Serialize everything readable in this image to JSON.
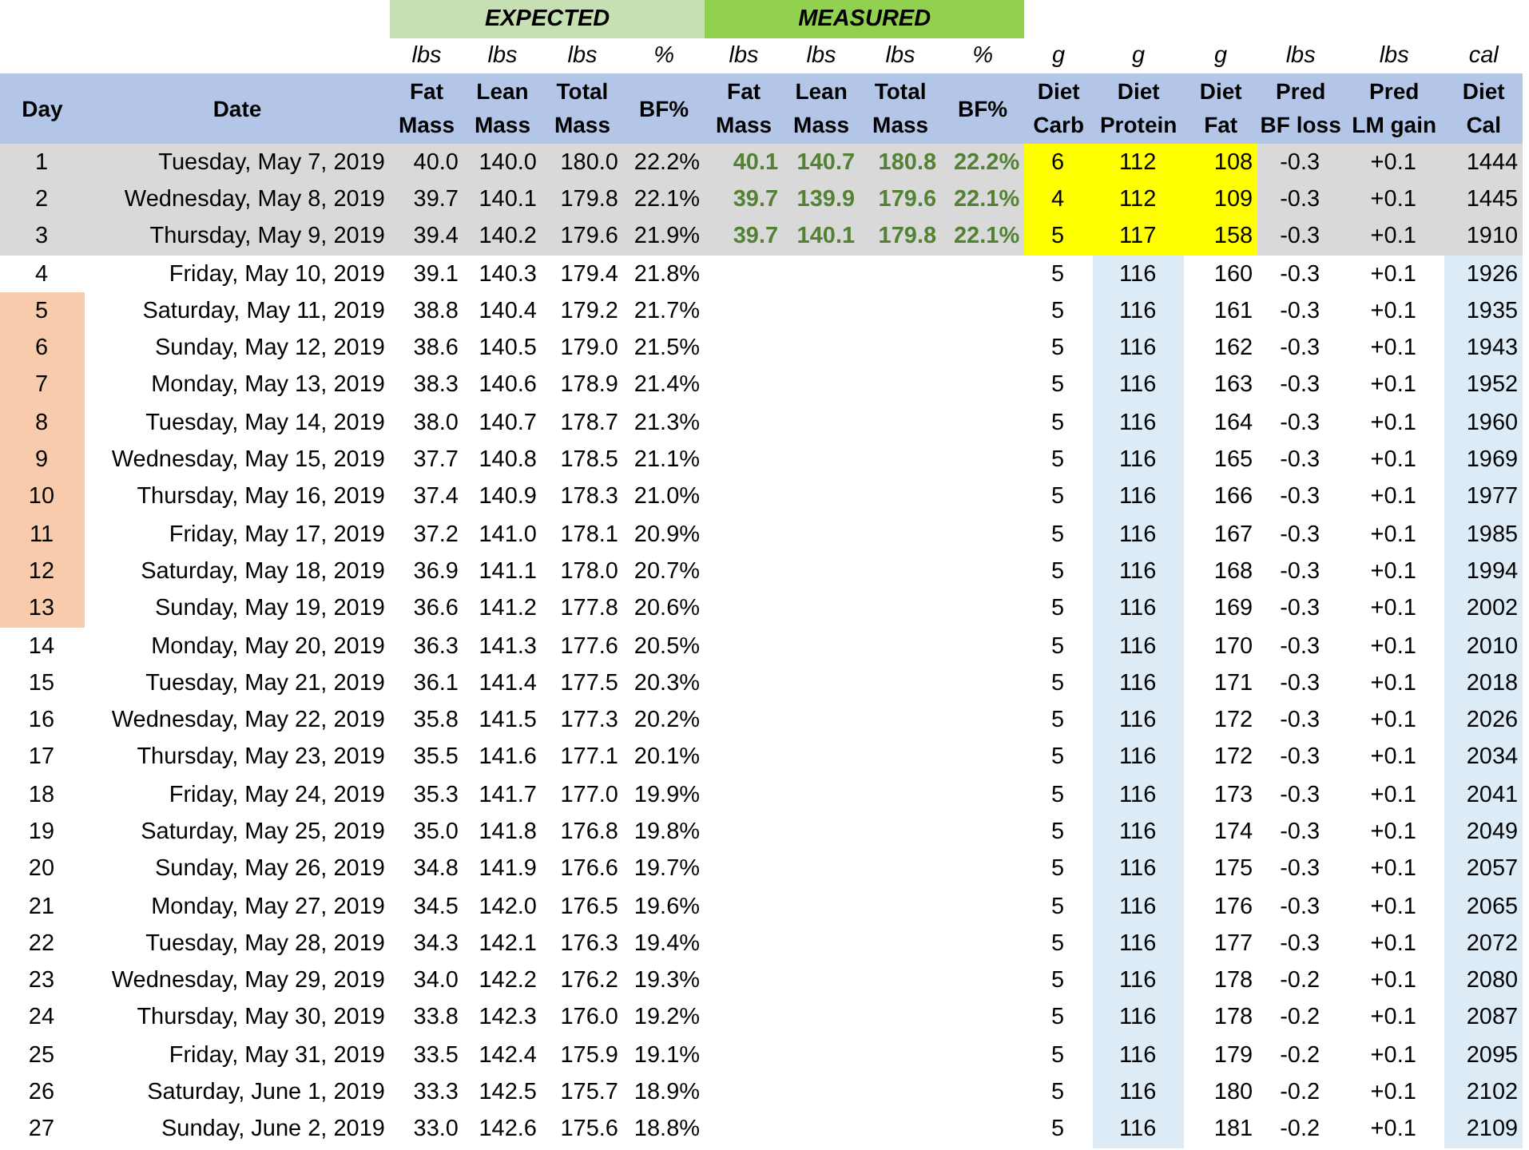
{
  "groups": [
    {
      "label": "EXPECTED",
      "kind": "expected"
    },
    {
      "label": "MEASURED",
      "kind": "measured"
    }
  ],
  "units": [
    "lbs",
    "lbs",
    "lbs",
    "%",
    "lbs",
    "lbs",
    "lbs",
    "%",
    "g",
    "g",
    "g",
    "lbs",
    "lbs",
    "cal"
  ],
  "columns": [
    [
      "Day"
    ],
    [
      "Date"
    ],
    [
      "Fat",
      "Mass"
    ],
    [
      "Lean",
      "Mass"
    ],
    [
      "Total",
      "Mass"
    ],
    [
      "BF%"
    ],
    [
      "Fat",
      "Mass"
    ],
    [
      "Lean",
      "Mass"
    ],
    [
      "Total",
      "Mass"
    ],
    [
      "BF%"
    ],
    [
      "Diet",
      "Carb"
    ],
    [
      "Diet",
      "Protein"
    ],
    [
      "Diet",
      "Fat"
    ],
    [
      "Pred",
      "BF loss"
    ],
    [
      "Pred",
      "LM gain"
    ],
    [
      "Diet",
      "Cal"
    ]
  ],
  "rows": [
    {
      "kind": "logged",
      "highlighted": false,
      "day": "1",
      "date": "Tuesday, May 7, 2019",
      "expected": [
        "40.0",
        "140.0",
        "180.0",
        "22.2%"
      ],
      "measured": [
        "40.1",
        "140.7",
        "180.8",
        "22.2%"
      ],
      "diet": [
        "6",
        "112",
        "108"
      ],
      "pred": [
        "-0.3",
        "+0.1"
      ],
      "cal": "1444"
    },
    {
      "kind": "logged",
      "highlighted": false,
      "day": "2",
      "date": "Wednesday, May 8, 2019",
      "expected": [
        "39.7",
        "140.1",
        "179.8",
        "22.1%"
      ],
      "measured": [
        "39.7",
        "139.9",
        "179.6",
        "22.1%"
      ],
      "diet": [
        "4",
        "112",
        "109"
      ],
      "pred": [
        "-0.3",
        "+0.1"
      ],
      "cal": "1445"
    },
    {
      "kind": "logged",
      "highlighted": false,
      "day": "3",
      "date": "Thursday, May 9, 2019",
      "expected": [
        "39.4",
        "140.2",
        "179.6",
        "21.9%"
      ],
      "measured": [
        "39.7",
        "140.1",
        "179.8",
        "22.1%"
      ],
      "diet": [
        "5",
        "117",
        "158"
      ],
      "pred": [
        "-0.3",
        "+0.1"
      ],
      "cal": "1910"
    },
    {
      "kind": "planned",
      "highlighted": false,
      "day": "4",
      "date": "Friday, May 10, 2019",
      "expected": [
        "39.1",
        "140.3",
        "179.4",
        "21.8%"
      ],
      "diet": [
        "5",
        "116",
        "160"
      ],
      "pred": [
        "-0.3",
        "+0.1"
      ],
      "cal": "1926"
    },
    {
      "kind": "planned",
      "highlighted": true,
      "day": "5",
      "date": "Saturday, May 11, 2019",
      "expected": [
        "38.8",
        "140.4",
        "179.2",
        "21.7%"
      ],
      "diet": [
        "5",
        "116",
        "161"
      ],
      "pred": [
        "-0.3",
        "+0.1"
      ],
      "cal": "1935"
    },
    {
      "kind": "planned",
      "highlighted": true,
      "day": "6",
      "date": "Sunday, May 12, 2019",
      "expected": [
        "38.6",
        "140.5",
        "179.0",
        "21.5%"
      ],
      "diet": [
        "5",
        "116",
        "162"
      ],
      "pred": [
        "-0.3",
        "+0.1"
      ],
      "cal": "1943"
    },
    {
      "kind": "planned",
      "highlighted": true,
      "day": "7",
      "date": "Monday, May 13, 2019",
      "expected": [
        "38.3",
        "140.6",
        "178.9",
        "21.4%"
      ],
      "diet": [
        "5",
        "116",
        "163"
      ],
      "pred": [
        "-0.3",
        "+0.1"
      ],
      "cal": "1952"
    },
    {
      "kind": "planned",
      "highlighted": true,
      "day": "8",
      "date": "Tuesday, May 14, 2019",
      "expected": [
        "38.0",
        "140.7",
        "178.7",
        "21.3%"
      ],
      "diet": [
        "5",
        "116",
        "164"
      ],
      "pred": [
        "-0.3",
        "+0.1"
      ],
      "cal": "1960"
    },
    {
      "kind": "planned",
      "highlighted": true,
      "day": "9",
      "date": "Wednesday, May 15, 2019",
      "expected": [
        "37.7",
        "140.8",
        "178.5",
        "21.1%"
      ],
      "diet": [
        "5",
        "116",
        "165"
      ],
      "pred": [
        "-0.3",
        "+0.1"
      ],
      "cal": "1969"
    },
    {
      "kind": "planned",
      "highlighted": true,
      "day": "10",
      "date": "Thursday, May 16, 2019",
      "expected": [
        "37.4",
        "140.9",
        "178.3",
        "21.0%"
      ],
      "diet": [
        "5",
        "116",
        "166"
      ],
      "pred": [
        "-0.3",
        "+0.1"
      ],
      "cal": "1977"
    },
    {
      "kind": "planned",
      "highlighted": true,
      "day": "11",
      "date": "Friday, May 17, 2019",
      "expected": [
        "37.2",
        "141.0",
        "178.1",
        "20.9%"
      ],
      "diet": [
        "5",
        "116",
        "167"
      ],
      "pred": [
        "-0.3",
        "+0.1"
      ],
      "cal": "1985"
    },
    {
      "kind": "planned",
      "highlighted": true,
      "day": "12",
      "date": "Saturday, May 18, 2019",
      "expected": [
        "36.9",
        "141.1",
        "178.0",
        "20.7%"
      ],
      "diet": [
        "5",
        "116",
        "168"
      ],
      "pred": [
        "-0.3",
        "+0.1"
      ],
      "cal": "1994"
    },
    {
      "kind": "planned",
      "highlighted": true,
      "day": "13",
      "date": "Sunday, May 19, 2019",
      "expected": [
        "36.6",
        "141.2",
        "177.8",
        "20.6%"
      ],
      "diet": [
        "5",
        "116",
        "169"
      ],
      "pred": [
        "-0.3",
        "+0.1"
      ],
      "cal": "2002"
    },
    {
      "kind": "planned",
      "highlighted": false,
      "day": "14",
      "date": "Monday, May 20, 2019",
      "expected": [
        "36.3",
        "141.3",
        "177.6",
        "20.5%"
      ],
      "diet": [
        "5",
        "116",
        "170"
      ],
      "pred": [
        "-0.3",
        "+0.1"
      ],
      "cal": "2010"
    },
    {
      "kind": "planned",
      "highlighted": false,
      "day": "15",
      "date": "Tuesday, May 21, 2019",
      "expected": [
        "36.1",
        "141.4",
        "177.5",
        "20.3%"
      ],
      "diet": [
        "5",
        "116",
        "171"
      ],
      "pred": [
        "-0.3",
        "+0.1"
      ],
      "cal": "2018"
    },
    {
      "kind": "planned",
      "highlighted": false,
      "day": "16",
      "date": "Wednesday, May 22, 2019",
      "expected": [
        "35.8",
        "141.5",
        "177.3",
        "20.2%"
      ],
      "diet": [
        "5",
        "116",
        "172"
      ],
      "pred": [
        "-0.3",
        "+0.1"
      ],
      "cal": "2026"
    },
    {
      "kind": "planned",
      "highlighted": false,
      "day": "17",
      "date": "Thursday, May 23, 2019",
      "expected": [
        "35.5",
        "141.6",
        "177.1",
        "20.1%"
      ],
      "diet": [
        "5",
        "116",
        "172"
      ],
      "pred": [
        "-0.3",
        "+0.1"
      ],
      "cal": "2034"
    },
    {
      "kind": "planned",
      "highlighted": false,
      "day": "18",
      "date": "Friday, May 24, 2019",
      "expected": [
        "35.3",
        "141.7",
        "177.0",
        "19.9%"
      ],
      "diet": [
        "5",
        "116",
        "173"
      ],
      "pred": [
        "-0.3",
        "+0.1"
      ],
      "cal": "2041"
    },
    {
      "kind": "planned",
      "highlighted": false,
      "day": "19",
      "date": "Saturday, May 25, 2019",
      "expected": [
        "35.0",
        "141.8",
        "176.8",
        "19.8%"
      ],
      "diet": [
        "5",
        "116",
        "174"
      ],
      "pred": [
        "-0.3",
        "+0.1"
      ],
      "cal": "2049"
    },
    {
      "kind": "planned",
      "highlighted": false,
      "day": "20",
      "date": "Sunday, May 26, 2019",
      "expected": [
        "34.8",
        "141.9",
        "176.6",
        "19.7%"
      ],
      "diet": [
        "5",
        "116",
        "175"
      ],
      "pred": [
        "-0.3",
        "+0.1"
      ],
      "cal": "2057"
    },
    {
      "kind": "planned",
      "highlighted": false,
      "day": "21",
      "date": "Monday, May 27, 2019",
      "expected": [
        "34.5",
        "142.0",
        "176.5",
        "19.6%"
      ],
      "diet": [
        "5",
        "116",
        "176"
      ],
      "pred": [
        "-0.3",
        "+0.1"
      ],
      "cal": "2065"
    },
    {
      "kind": "planned",
      "highlighted": false,
      "day": "22",
      "date": "Tuesday, May 28, 2019",
      "expected": [
        "34.3",
        "142.1",
        "176.3",
        "19.4%"
      ],
      "diet": [
        "5",
        "116",
        "177"
      ],
      "pred": [
        "-0.3",
        "+0.1"
      ],
      "cal": "2072"
    },
    {
      "kind": "planned",
      "highlighted": false,
      "day": "23",
      "date": "Wednesday, May 29, 2019",
      "expected": [
        "34.0",
        "142.2",
        "176.2",
        "19.3%"
      ],
      "diet": [
        "5",
        "116",
        "178"
      ],
      "pred": [
        "-0.2",
        "+0.1"
      ],
      "cal": "2080"
    },
    {
      "kind": "planned",
      "highlighted": false,
      "day": "24",
      "date": "Thursday, May 30, 2019",
      "expected": [
        "33.8",
        "142.3",
        "176.0",
        "19.2%"
      ],
      "diet": [
        "5",
        "116",
        "178"
      ],
      "pred": [
        "-0.2",
        "+0.1"
      ],
      "cal": "2087"
    },
    {
      "kind": "planned",
      "highlighted": false,
      "day": "25",
      "date": "Friday, May 31, 2019",
      "expected": [
        "33.5",
        "142.4",
        "175.9",
        "19.1%"
      ],
      "diet": [
        "5",
        "116",
        "179"
      ],
      "pred": [
        "-0.2",
        "+0.1"
      ],
      "cal": "2095"
    },
    {
      "kind": "planned",
      "highlighted": false,
      "day": "26",
      "date": "Saturday, June 1, 2019",
      "expected": [
        "33.3",
        "142.5",
        "175.7",
        "18.9%"
      ],
      "diet": [
        "5",
        "116",
        "180"
      ],
      "pred": [
        "-0.2",
        "+0.1"
      ],
      "cal": "2102"
    },
    {
      "kind": "planned",
      "highlighted": false,
      "day": "27",
      "date": "Sunday, June 2, 2019",
      "expected": [
        "33.0",
        "142.6",
        "175.6",
        "18.8%"
      ],
      "diet": [
        "5",
        "116",
        "181"
      ],
      "pred": [
        "-0.2",
        "+0.1"
      ],
      "cal": "2109"
    }
  ]
}
